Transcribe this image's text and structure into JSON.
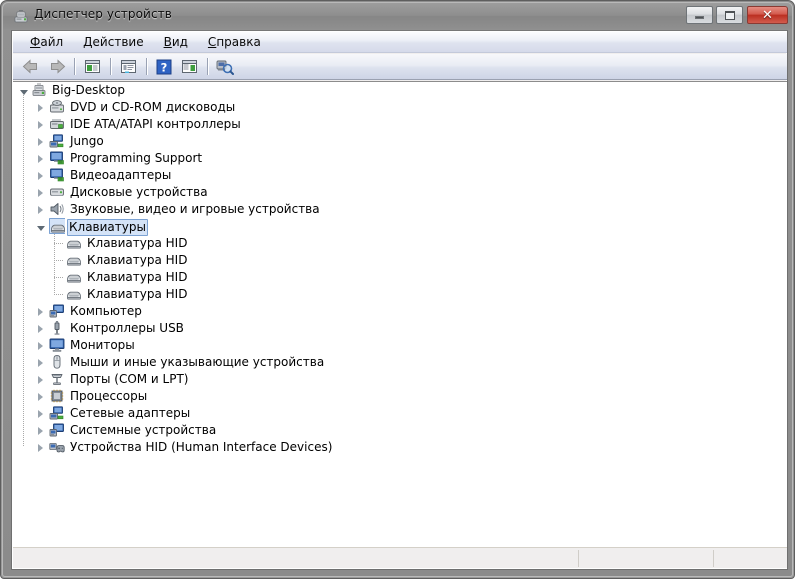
{
  "window": {
    "title": "Диспетчер устройств",
    "icon": "device-manager-icon",
    "controls": {
      "minimize_label": "",
      "maximize_label": "",
      "close_label": "✕"
    }
  },
  "menubar": {
    "items": [
      {
        "accel": "Ф",
        "rest": "айл"
      },
      {
        "accel": "Д",
        "rest": "ействие"
      },
      {
        "accel": "В",
        "rest": "ид"
      },
      {
        "accel": "С",
        "rest": "правка"
      }
    ]
  },
  "toolbar": {
    "buttons": [
      {
        "name": "back-button",
        "icon": "back-arrow-icon",
        "enabled": false
      },
      {
        "name": "forward-button",
        "icon": "forward-arrow-icon",
        "enabled": false
      },
      {
        "name": "show-hide-console-tree-button",
        "icon": "console-tree-icon",
        "enabled": true
      },
      {
        "name": "properties-button",
        "icon": "properties-window-icon",
        "enabled": true
      },
      {
        "name": "help-button",
        "icon": "help-question-icon",
        "enabled": true
      },
      {
        "name": "update-driver-button",
        "icon": "action-pane-icon",
        "enabled": true
      },
      {
        "name": "scan-for-hardware-changes-button",
        "icon": "scan-hardware-icon",
        "enabled": true
      }
    ]
  },
  "tree": {
    "root": {
      "label": "Big-Desktop",
      "icon": "computer-root-icon",
      "expanded": true
    },
    "nodes": [
      {
        "label": "DVD и CD-ROM дисководы",
        "icon": "dvd-drive-icon",
        "expanded": false,
        "selected": false,
        "depth": 1
      },
      {
        "label": "IDE ATA/ATAPI контроллеры",
        "icon": "ide-controller-icon",
        "expanded": false,
        "selected": false,
        "depth": 1
      },
      {
        "label": "Jungo",
        "icon": "network-device-icon",
        "expanded": false,
        "selected": false,
        "depth": 1
      },
      {
        "label": "Programming Support",
        "icon": "display-adapter-icon",
        "expanded": false,
        "selected": false,
        "depth": 1
      },
      {
        "label": "Видеоадаптеры",
        "icon": "display-adapter-icon",
        "expanded": false,
        "selected": false,
        "depth": 1
      },
      {
        "label": "Дисковые устройства",
        "icon": "disk-drive-icon",
        "expanded": false,
        "selected": false,
        "depth": 1
      },
      {
        "label": "Звуковые, видео и игровые устройства",
        "icon": "sound-speaker-icon",
        "expanded": false,
        "selected": false,
        "depth": 1
      },
      {
        "label": "Клавиатуры",
        "icon": "keyboard-icon",
        "expanded": true,
        "selected": true,
        "depth": 1
      },
      {
        "label": "Клавиатура HID",
        "icon": "keyboard-icon",
        "expanded": null,
        "selected": false,
        "depth": 2
      },
      {
        "label": "Клавиатура HID",
        "icon": "keyboard-icon",
        "expanded": null,
        "selected": false,
        "depth": 2
      },
      {
        "label": "Клавиатура HID",
        "icon": "keyboard-icon",
        "expanded": null,
        "selected": false,
        "depth": 2
      },
      {
        "label": "Клавиатура HID",
        "icon": "keyboard-icon",
        "expanded": null,
        "selected": false,
        "depth": 2
      },
      {
        "label": "Компьютер",
        "icon": "computer-icon",
        "expanded": false,
        "selected": false,
        "depth": 1
      },
      {
        "label": "Контроллеры USB",
        "icon": "usb-icon",
        "expanded": false,
        "selected": false,
        "depth": 1
      },
      {
        "label": "Мониторы",
        "icon": "monitor-icon",
        "expanded": false,
        "selected": false,
        "depth": 1
      },
      {
        "label": "Мыши и иные указывающие устройства",
        "icon": "mouse-icon",
        "expanded": false,
        "selected": false,
        "depth": 1
      },
      {
        "label": "Порты (COM и LPT)",
        "icon": "port-icon",
        "expanded": false,
        "selected": false,
        "depth": 1
      },
      {
        "label": "Процессоры",
        "icon": "processor-icon",
        "expanded": false,
        "selected": false,
        "depth": 1
      },
      {
        "label": "Сетевые адаптеры",
        "icon": "network-adapter-icon",
        "expanded": false,
        "selected": false,
        "depth": 1
      },
      {
        "label": "Системные устройства",
        "icon": "system-device-icon",
        "expanded": false,
        "selected": false,
        "depth": 1
      },
      {
        "label": "Устройства HID (Human Interface Devices)",
        "icon": "hid-device-icon",
        "expanded": false,
        "selected": false,
        "depth": 1
      }
    ]
  },
  "statusbar": {
    "panes": [
      "",
      "",
      ""
    ]
  },
  "colors": {
    "selection_fill": "#d4e3f7",
    "selection_border": "#7ca2d3",
    "close_button": "#bb2e20",
    "tree_background": "#ffffff",
    "menu_background": "#e7ebf5"
  }
}
